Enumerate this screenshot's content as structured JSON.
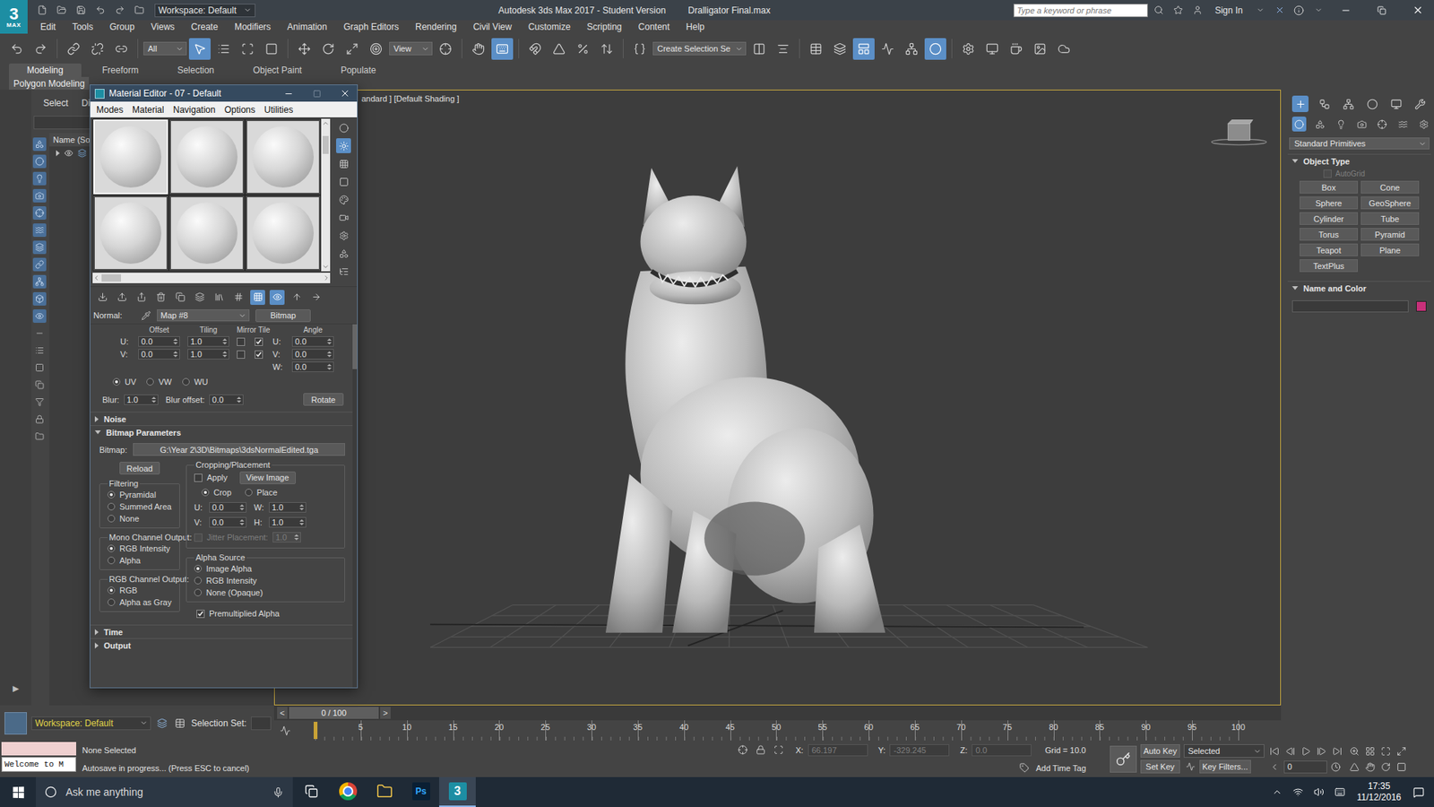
{
  "app": {
    "logo_digit": "3",
    "logo_word": "MAX"
  },
  "title_bar": {
    "workspace": "Workspace: Default",
    "title": "Autodesk 3ds Max 2017 - Student Version",
    "file": "Dralligator Final.max",
    "search_placeholder": "Type a keyword or phrase",
    "sign_in": "Sign In"
  },
  "menu": [
    "Edit",
    "Tools",
    "Group",
    "Views",
    "Create",
    "Modifiers",
    "Animation",
    "Graph Editors",
    "Rendering",
    "Civil View",
    "Customize",
    "Scripting",
    "Content",
    "Help"
  ],
  "main_toolbar": [
    {
      "kind": "button",
      "selected": false
    },
    {
      "kind": "button",
      "selected": false
    },
    {
      "kind": "separator"
    },
    {
      "kind": "button",
      "selected": false
    },
    {
      "kind": "button",
      "selected": false
    },
    {
      "kind": "button",
      "selected": false
    },
    {
      "kind": "separator"
    },
    {
      "kind": "dropdown",
      "label": "All"
    },
    {
      "kind": "button",
      "selected": true
    },
    {
      "kind": "button",
      "selected": false
    },
    {
      "kind": "button",
      "selected": false
    },
    {
      "kind": "button",
      "selected": false
    },
    {
      "kind": "separator"
    },
    {
      "kind": "button",
      "selected": false
    },
    {
      "kind": "button",
      "selected": false
    },
    {
      "kind": "button",
      "selected": false
    },
    {
      "kind": "button",
      "selected": false
    },
    {
      "kind": "dropdown",
      "label": "View"
    },
    {
      "kind": "button",
      "selected": false
    },
    {
      "kind": "separator"
    },
    {
      "kind": "button",
      "selected": false
    },
    {
      "kind": "button",
      "selected": true
    },
    {
      "kind": "separator"
    },
    {
      "kind": "button",
      "selected": false
    },
    {
      "kind": "button",
      "selected": false
    },
    {
      "kind": "button",
      "selected": false
    },
    {
      "kind": "button",
      "selected": false
    },
    {
      "kind": "separator"
    },
    {
      "kind": "button",
      "selected": false
    },
    {
      "kind": "dropdown",
      "label": "Create Selection Se"
    },
    {
      "kind": "button",
      "selected": false
    },
    {
      "kind": "button",
      "selected": false
    },
    {
      "kind": "separator"
    },
    {
      "kind": "button",
      "selected": false
    },
    {
      "kind": "button",
      "selected": false
    },
    {
      "kind": "button",
      "selected": true
    },
    {
      "kind": "button",
      "selected": false
    },
    {
      "kind": "button",
      "selected": false
    },
    {
      "kind": "button",
      "selected": true
    },
    {
      "kind": "separator"
    },
    {
      "kind": "button",
      "selected": false
    },
    {
      "kind": "button",
      "selected": false
    },
    {
      "kind": "button",
      "selected": false
    },
    {
      "kind": "button",
      "selected": false
    },
    {
      "kind": "button",
      "selected": false
    }
  ],
  "ribbon": {
    "tabs": [
      {
        "label": "Modeling",
        "selected": true
      },
      {
        "label": "Freeform",
        "selected": false
      },
      {
        "label": "Selection",
        "selected": false
      },
      {
        "label": "Object Paint",
        "selected": false
      },
      {
        "label": "Populate",
        "selected": false
      }
    ],
    "panel": "Polygon Modeling"
  },
  "left_strip": {
    "expand": "▶"
  },
  "scene_explorer": {
    "tabs": [
      "Select",
      "Di"
    ],
    "column": "Name (Sor",
    "rows": [
      {
        "expanded": false,
        "visible": true
      }
    ],
    "tools": [
      true,
      true,
      true,
      true,
      true,
      true,
      true,
      true,
      true,
      true,
      true,
      false,
      false,
      false,
      false,
      false,
      false,
      false
    ]
  },
  "viewport": {
    "label": "andard ] [Default Shading ]",
    "active": true
  },
  "material_editor": {
    "title": "Material Editor - 07 - Default",
    "menu": [
      "Modes",
      "Material",
      "Navigation",
      "Options",
      "Utilities"
    ],
    "slots": [
      {
        "selected": true
      },
      {
        "selected": false
      },
      {
        "selected": false
      },
      {
        "selected": false
      },
      {
        "selected": false
      },
      {
        "selected": false
      }
    ],
    "toolbar": [
      false,
      false,
      false,
      false,
      false,
      false,
      false,
      false,
      true,
      true,
      false,
      false
    ],
    "side_toolbar": [
      false,
      true,
      false,
      false,
      false,
      false,
      false,
      false,
      false
    ],
    "map_label": "Normal:",
    "map_name": "Map #8",
    "map_type": "Bitmap",
    "coordinates": {
      "headers": [
        "Offset",
        "Tiling",
        "Mirror Tile",
        "Angle"
      ],
      "rows": [
        {
          "axis": "U:",
          "offset": "0.0",
          "tiling": "1.0",
          "mirror": false,
          "tile": true,
          "angle_axis": "U:",
          "angle": "0.0"
        },
        {
          "axis": "V:",
          "offset": "0.0",
          "tiling": "1.0",
          "mirror": false,
          "tile": true,
          "angle_axis": "V:",
          "angle": "0.0"
        }
      ],
      "w_axis": "W:",
      "w_angle": "0.0",
      "mapping": [
        {
          "label": "UV",
          "selected": true
        },
        {
          "label": "VW",
          "selected": false
        },
        {
          "label": "WU",
          "selected": false
        }
      ],
      "blur_label": "Blur:",
      "blur": "1.0",
      "blur_offset_label": "Blur offset:",
      "blur_offset": "0.0",
      "rotate": "Rotate"
    },
    "rollouts_before": [
      {
        "label": "Noise",
        "expanded": false
      }
    ],
    "bitmap_params": {
      "label": "Bitmap Parameters",
      "expanded": true,
      "bitmap_label": "Bitmap:",
      "path": "G:\\Year 2\\3D\\Bitmaps\\3dsNormalEdited.tga",
      "reload": "Reload",
      "filtering": {
        "title": "Filtering",
        "options": [
          {
            "label": "Pyramidal",
            "selected": true
          },
          {
            "label": "Summed Area",
            "selected": false
          },
          {
            "label": "None",
            "selected": false
          }
        ]
      },
      "mono": {
        "title": "Mono Channel Output:",
        "options": [
          {
            "label": "RGB Intensity",
            "selected": true
          },
          {
            "label": "Alpha",
            "selected": false
          }
        ]
      },
      "rgb": {
        "title": "RGB Channel Output:",
        "options": [
          {
            "label": "RGB",
            "selected": true
          },
          {
            "label": "Alpha as Gray",
            "selected": false
          }
        ]
      },
      "cropping": {
        "title": "Cropping/Placement",
        "apply_label": "Apply",
        "apply": false,
        "view_image": "View Image",
        "modes": [
          {
            "label": "Crop",
            "selected": true
          },
          {
            "label": "Place",
            "selected": false
          }
        ],
        "fields": [
          {
            "label": "U:",
            "value": "0.0"
          },
          {
            "label": "W:",
            "value": "1.0"
          },
          {
            "label": "V:",
            "value": "0.0"
          },
          {
            "label": "H:",
            "value": "1.0"
          }
        ],
        "jitter_label": "Jitter Placement:",
        "jitter": "1.0",
        "jitter_disabled": true
      },
      "alpha": {
        "title": "Alpha Source",
        "options": [
          {
            "label": "Image Alpha",
            "selected": true
          },
          {
            "label": "RGB Intensity",
            "selected": false
          },
          {
            "label": "None (Opaque)",
            "selected": false
          }
        ]
      },
      "premultiplied_label": "Premultiplied Alpha",
      "premultiplied": true
    },
    "rollouts_after": [
      {
        "label": "Time",
        "expanded": false
      },
      {
        "label": "Output",
        "expanded": false
      }
    ]
  },
  "command_panel": {
    "tabs": [
      true,
      false,
      false,
      false,
      false,
      false
    ],
    "categories": [
      true,
      false,
      false,
      false,
      false,
      false,
      false
    ],
    "dropdown": "Standard Primitives",
    "object_type": {
      "title": "Object Type",
      "expanded": true,
      "autogrid_label": "AutoGrid",
      "autogrid": false,
      "autogrid_disabled": true,
      "buttons": [
        "Box",
        "Cone",
        "Sphere",
        "GeoSphere",
        "Cylinder",
        "Tube",
        "Torus",
        "Pyramid",
        "Teapot",
        "Plane",
        "TextPlus"
      ]
    },
    "name_color": {
      "title": "Name and Color",
      "expanded": true,
      "name": "",
      "color": "#c8307a"
    }
  },
  "time_slider": {
    "prev": "<",
    "position": "0 / 100",
    "next": ">",
    "level": 0
  },
  "track_bar": {
    "ticks": [
      "5",
      "10",
      "15",
      "20",
      "25",
      "30",
      "35",
      "40",
      "45",
      "50",
      "55",
      "60",
      "65",
      "70",
      "75",
      "80",
      "85",
      "90",
      "95",
      "100"
    ],
    "current_frame": 0
  },
  "bottom_left": {
    "workspace": "Workspace: Default",
    "selection_set": "Selection Set:",
    "listener": "Welcome to M"
  },
  "status": {
    "selection": "None Selected",
    "prompt": "Autosave in progress... (Press ESC to cancel)",
    "x_label": "X:",
    "x": "66.197",
    "y_label": "Y:",
    "y": "-329.245",
    "z_label": "Z:",
    "z": "0.0",
    "coords_disabled": true,
    "grid": "Grid = 10.0",
    "time_tag": "Add Time Tag"
  },
  "animation": {
    "auto_key": "Auto Key",
    "auto_key_on": false,
    "set_key": "Set Key",
    "key_mode": "Selected",
    "key_filters": "Key Filters...",
    "frame": "0"
  },
  "taskbar": {
    "search": "Ask me anything",
    "apps": [
      {
        "kind": "chrome",
        "selected": false
      },
      {
        "kind": "explorer",
        "selected": false
      },
      {
        "kind": "photoshop",
        "label": "Ps",
        "selected": false
      },
      {
        "kind": "max",
        "label": "3",
        "selected": true
      }
    ],
    "time": "17:35",
    "date": "11/12/2016"
  }
}
